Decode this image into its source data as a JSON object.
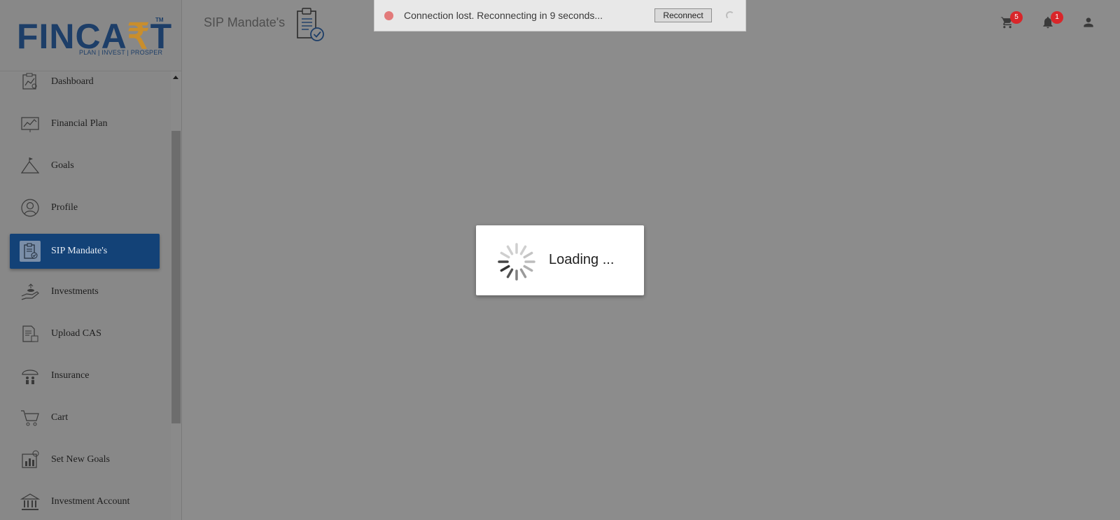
{
  "brand": {
    "name_pre": "FINCA",
    "name_symbol": "₹",
    "name_post": "T",
    "tm": "TM",
    "tagline": "PLAN | INVEST | PROSPER"
  },
  "header": {
    "title": "SIP Mandate's",
    "cart_count": "5",
    "notification_count": "1"
  },
  "sidebar": {
    "items": [
      {
        "label": "Dashboard",
        "icon": "dashboard-icon"
      },
      {
        "label": "Financial Plan",
        "icon": "chart-icon"
      },
      {
        "label": "Goals",
        "icon": "mountain-flag-icon"
      },
      {
        "label": "Profile",
        "icon": "user-circle-icon"
      },
      {
        "label": "SIP Mandate's",
        "icon": "clipboard-check-icon",
        "active": true
      },
      {
        "label": "Investments",
        "icon": "hand-coin-icon"
      },
      {
        "label": "Upload CAS",
        "icon": "document-upload-icon"
      },
      {
        "label": "Insurance",
        "icon": "umbrella-family-icon"
      },
      {
        "label": "Cart",
        "icon": "cart-icon"
      },
      {
        "label": "Set New Goals",
        "icon": "target-chart-icon"
      },
      {
        "label": "Investment Account",
        "icon": "bank-icon"
      }
    ]
  },
  "connection": {
    "message": "Connection lost. Reconnecting in 9 seconds...",
    "button_label": "Reconnect"
  },
  "loading": {
    "text": "Loading  ..."
  },
  "colors": {
    "brand_blue": "#1d3e68",
    "brand_gold": "#c98e2c",
    "active_nav": "#134277",
    "badge_red": "#d9262a",
    "overlay_gray": "#8c8c8c"
  }
}
